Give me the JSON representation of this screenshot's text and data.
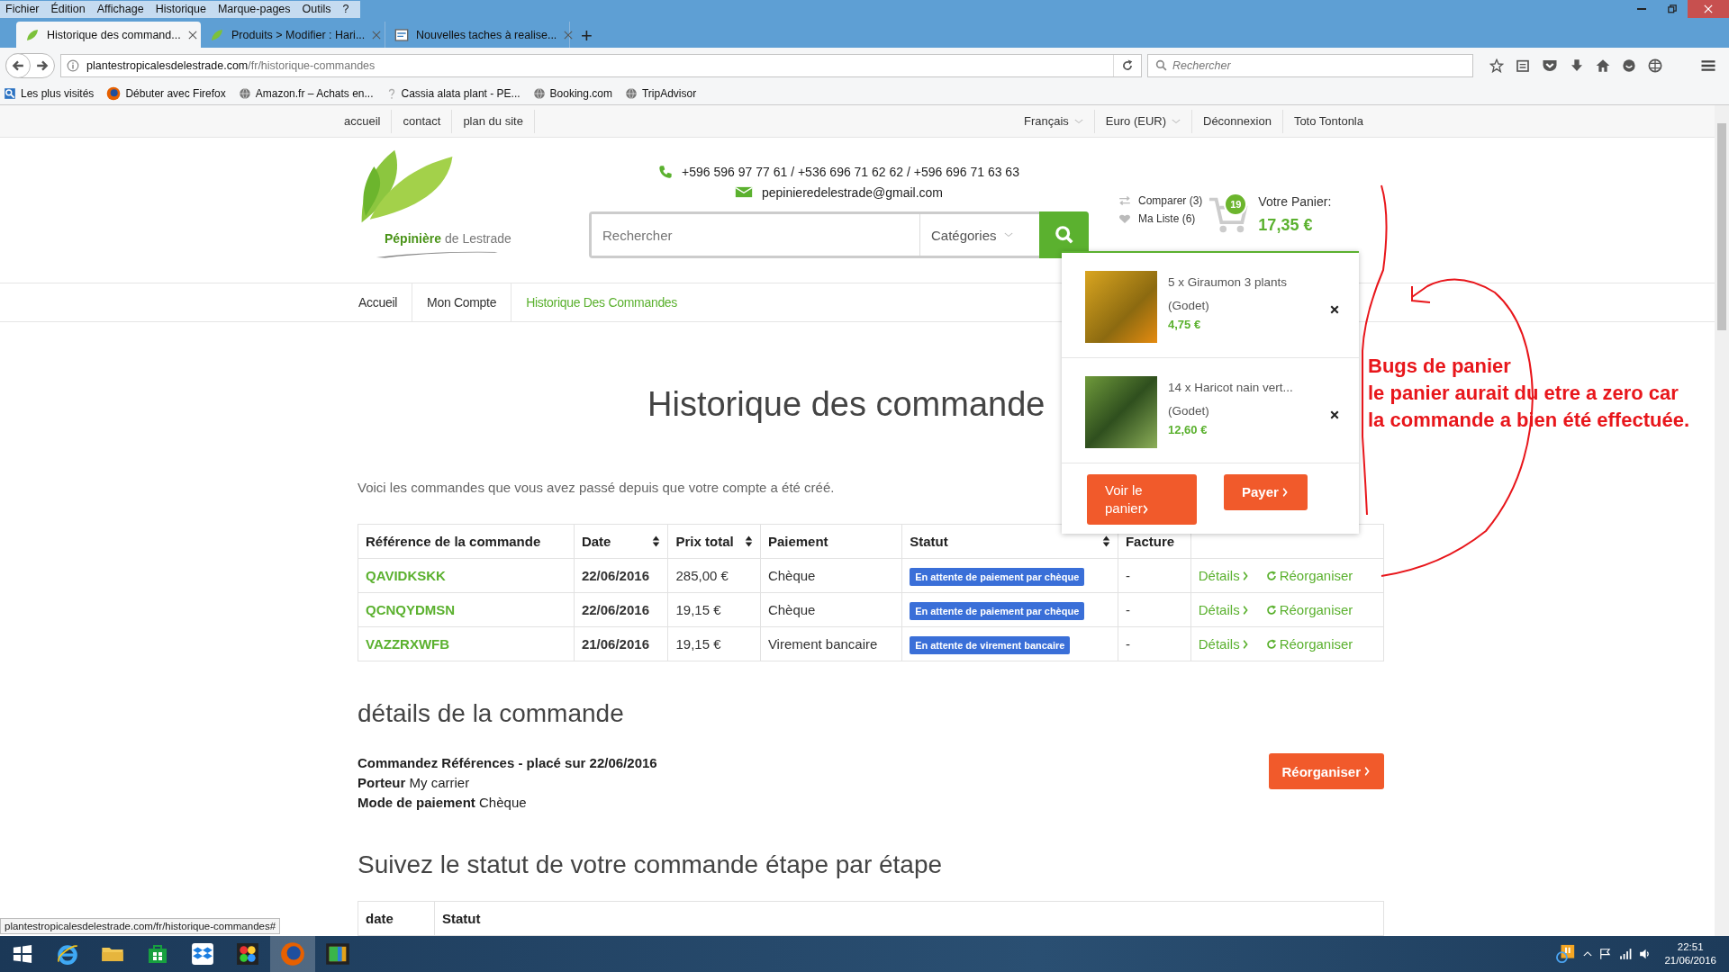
{
  "browser": {
    "menu": [
      "Fichier",
      "Édition",
      "Affichage",
      "Historique",
      "Marque-pages",
      "Outils",
      "?"
    ],
    "tabs": [
      {
        "title": "Historique des command...",
        "selected": true,
        "kind": "leaf"
      },
      {
        "title": "Produits > Modifier : Hari...",
        "selected": false,
        "kind": "leaf"
      },
      {
        "title": "Nouvelles taches à realise...",
        "selected": false,
        "kind": "doc"
      }
    ],
    "new_tab": "+",
    "url": {
      "host": "plantestropicalesdelestrade.com",
      "path": "/fr/historique-commandes"
    },
    "search_placeholder": "Rechercher",
    "bookmarks": [
      {
        "label": "Les plus visités",
        "kind": "search"
      },
      {
        "label": "Débuter avec Firefox",
        "kind": "firefox"
      },
      {
        "label": "Amazon.fr – Achats en...",
        "kind": "globe"
      },
      {
        "label": "Cassia alata plant - PE...",
        "kind": "unknown"
      },
      {
        "label": "Booking.com",
        "kind": "globe"
      },
      {
        "label": "TripAdvisor",
        "kind": "globe"
      }
    ]
  },
  "site": {
    "top_links": [
      "accueil",
      "contact",
      "plan du site"
    ],
    "top_right": [
      {
        "label": "Français",
        "dropdown": true
      },
      {
        "label": "Euro (EUR)",
        "dropdown": true
      },
      {
        "label": "Déconnexion",
        "dropdown": false
      },
      {
        "label": "Toto Tontonla",
        "dropdown": false
      }
    ],
    "logo": {
      "name": "Pépinière",
      "suffix": "de Lestrade"
    },
    "phone": "+596 596 97 77 61 / +536 696 71 62 62 / +596 696 71 63 63",
    "email": "pepinieredelestrade@gmail.com",
    "search": {
      "placeholder": "Rechercher",
      "category": "Catégories"
    },
    "compare": "Comparer (3)",
    "wishlist": "Ma Liste (6)",
    "cart": {
      "count": "19",
      "label": "Votre Panier:",
      "total": "17,35 €",
      "items": [
        {
          "name": "5 x Giraumon 3 plants",
          "variant": "(Godet)",
          "price": "4,75 €",
          "kind": "squash"
        },
        {
          "name": "14 x Haricot nain vert...",
          "variant": "(Godet)",
          "price": "12,60 €",
          "kind": "beans"
        }
      ],
      "view_button": "Voir le panier",
      "pay_button": "Payer"
    },
    "nav": [
      {
        "label": "Accueil",
        "selected": false
      },
      {
        "label": "Mon Compte",
        "selected": false
      },
      {
        "label": "Historique Des Commandes",
        "selected": true
      }
    ],
    "page": {
      "title": "Historique des commande",
      "intro": "Voici les commandes que vous avez passé depuis que votre compte a été créé.",
      "columns": [
        {
          "label": "Référence de la commande",
          "sortable": false
        },
        {
          "label": "Date",
          "sortable": true
        },
        {
          "label": "Prix total",
          "sortable": true
        },
        {
          "label": "Paiement",
          "sortable": false
        },
        {
          "label": "Statut",
          "sortable": true
        },
        {
          "label": "Facture",
          "sortable": false
        }
      ],
      "rows": [
        {
          "ref": "QAVIDKSKK",
          "date": "22/06/2016",
          "total": "285,00 €",
          "payment": "Chèque",
          "status": "En attente de paiement par chèque",
          "invoice": "-",
          "details": "Détails",
          "reorder": "Réorganiser"
        },
        {
          "ref": "QCNQYDMSN",
          "date": "22/06/2016",
          "total": "19,15 €",
          "payment": "Chèque",
          "status": "En attente de paiement par chèque",
          "invoice": "-",
          "details": "Détails",
          "reorder": "Réorganiser"
        },
        {
          "ref": "VAZZRXWFB",
          "date": "21/06/2016",
          "total": "19,15 €",
          "payment": "Virement bancaire",
          "status": "En attente de virement bancaire",
          "invoice": "-",
          "details": "Détails",
          "reorder": "Réorganiser"
        }
      ],
      "details_title": "détails de la commande",
      "details": [
        "**Commandez Références - placé sur 22/06/2016**",
        "**Porteur** My carrier",
        "**Mode de paiement** Chèque"
      ],
      "reorder_button": "Réorganiser",
      "steps_title": "Suivez le statut de votre commande étape par étape",
      "steps_columns": [
        "date",
        "Statut"
      ]
    }
  },
  "status_url": "plantestropicalesdelestrade.com/fr/historique-commandes#",
  "annotation": [
    "Bugs de panier",
    "le panier aurait du etre a zero car",
    "la commande a bien été effectuée."
  ],
  "taskbar": {
    "apps": [
      {
        "kind": "ie",
        "selected": false
      },
      {
        "kind": "folder",
        "selected": false
      },
      {
        "kind": "store",
        "selected": false
      },
      {
        "kind": "dropbox",
        "selected": false
      },
      {
        "kind": "paint",
        "selected": false
      },
      {
        "kind": "firefox",
        "selected": true
      },
      {
        "kind": "video",
        "selected": false
      }
    ],
    "time": "22:51",
    "date": "21/06/2016"
  }
}
